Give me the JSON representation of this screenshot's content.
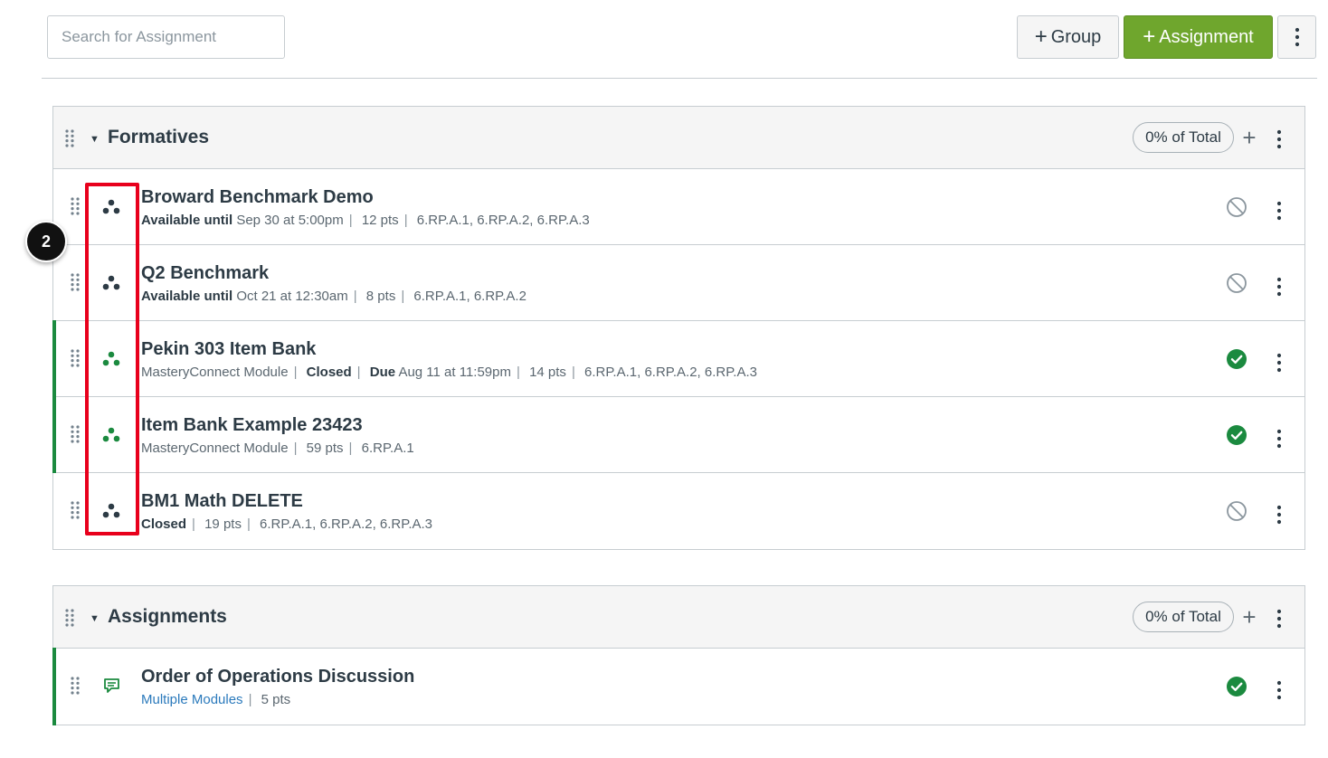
{
  "toolbar": {
    "search_placeholder": "Search for Assignment",
    "group_button": "Group",
    "assignment_button": "Assignment"
  },
  "colors": {
    "accent_green": "#6fa62d",
    "published_green": "#1b8a3f",
    "link_blue": "#2b7abc",
    "annotation_red": "#e8001c"
  },
  "annotation": {
    "badge": "2"
  },
  "groups": [
    {
      "title": "Formatives",
      "weight": "0% of Total",
      "items": [
        {
          "title": "Broward Benchmark Demo",
          "icon": "masteryconnect-icon",
          "status": "unpublished",
          "meta": {
            "avail_label": "Available until",
            "avail_value": "Sep 30 at 5:00pm",
            "points": "12 pts",
            "standards": "6.RP.A.1, 6.RP.A.2, 6.RP.A.3"
          }
        },
        {
          "title": "Q2 Benchmark",
          "icon": "masteryconnect-icon",
          "status": "unpublished",
          "meta": {
            "avail_label": "Available until",
            "avail_value": "Oct 21 at 12:30am",
            "points": "8 pts",
            "standards": "6.RP.A.1, 6.RP.A.2"
          }
        },
        {
          "title": "Pekin 303 Item Bank",
          "icon": "masteryconnect-icon",
          "status": "published",
          "meta": {
            "module": "MasteryConnect Module",
            "closed": "Closed",
            "due_label": "Due",
            "due_value": "Aug 11 at 11:59pm",
            "points": "14 pts",
            "standards": "6.RP.A.1, 6.RP.A.2, 6.RP.A.3"
          }
        },
        {
          "title": "Item Bank Example 23423",
          "icon": "masteryconnect-icon",
          "status": "published",
          "meta": {
            "module": "MasteryConnect Module",
            "points": "59 pts",
            "standards": "6.RP.A.1"
          }
        },
        {
          "title": "BM1 Math DELETE",
          "icon": "masteryconnect-icon",
          "status": "unpublished",
          "meta": {
            "closed": "Closed",
            "points": "19 pts",
            "standards": "6.RP.A.1, 6.RP.A.2, 6.RP.A.3"
          }
        }
      ]
    },
    {
      "title": "Assignments",
      "weight": "0% of Total",
      "items": [
        {
          "title": "Order of Operations Discussion",
          "icon": "discussion-icon",
          "status": "published",
          "meta": {
            "module_link": "Multiple Modules",
            "points": "5 pts"
          }
        }
      ]
    }
  ]
}
